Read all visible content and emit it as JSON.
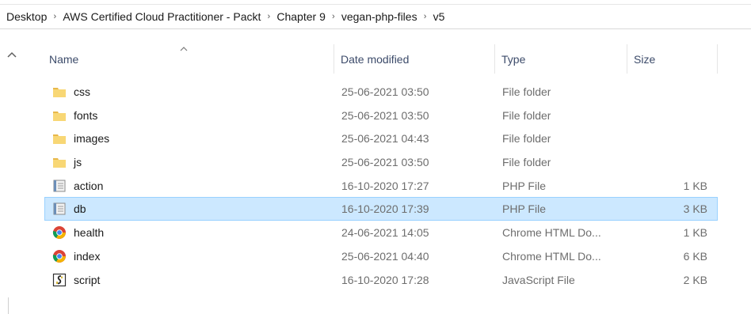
{
  "breadcrumb": [
    {
      "label": "Desktop"
    },
    {
      "label": "AWS Certified Cloud Practitioner - Packt"
    },
    {
      "label": "Chapter 9"
    },
    {
      "label": "vegan-php-files"
    },
    {
      "label": "v5"
    }
  ],
  "breadcrumb_separator": "›",
  "columns": {
    "name": "Name",
    "date": "Date modified",
    "type": "Type",
    "size": "Size"
  },
  "files": [
    {
      "name": "css",
      "date": "25-06-2021 03:50",
      "type": "File folder",
      "size": "",
      "icon": "folder-icon",
      "selected": false
    },
    {
      "name": "fonts",
      "date": "25-06-2021 03:50",
      "type": "File folder",
      "size": "",
      "icon": "folder-icon",
      "selected": false
    },
    {
      "name": "images",
      "date": "25-06-2021 04:43",
      "type": "File folder",
      "size": "",
      "icon": "folder-icon",
      "selected": false
    },
    {
      "name": "js",
      "date": "25-06-2021 03:50",
      "type": "File folder",
      "size": "",
      "icon": "folder-icon",
      "selected": false
    },
    {
      "name": "action",
      "date": "16-10-2020 17:27",
      "type": "PHP File",
      "size": "1 KB",
      "icon": "php-file-icon",
      "selected": false
    },
    {
      "name": "db",
      "date": "16-10-2020 17:39",
      "type": "PHP File",
      "size": "3 KB",
      "icon": "php-file-icon",
      "selected": true
    },
    {
      "name": "health",
      "date": "24-06-2021 14:05",
      "type": "Chrome HTML Do...",
      "size": "1 KB",
      "icon": "chrome-icon",
      "selected": false
    },
    {
      "name": "index",
      "date": "25-06-2021 04:40",
      "type": "Chrome HTML Do...",
      "size": "6 KB",
      "icon": "chrome-icon",
      "selected": false
    },
    {
      "name": "script",
      "date": "16-10-2020 17:28",
      "type": "JavaScript File",
      "size": "2 KB",
      "icon": "js-script-icon",
      "selected": false
    }
  ],
  "colors": {
    "selected_bg": "#cce8ff",
    "selected_border": "#99d1ff",
    "folder": "#f4c752",
    "header_text": "#3c4b6a"
  }
}
